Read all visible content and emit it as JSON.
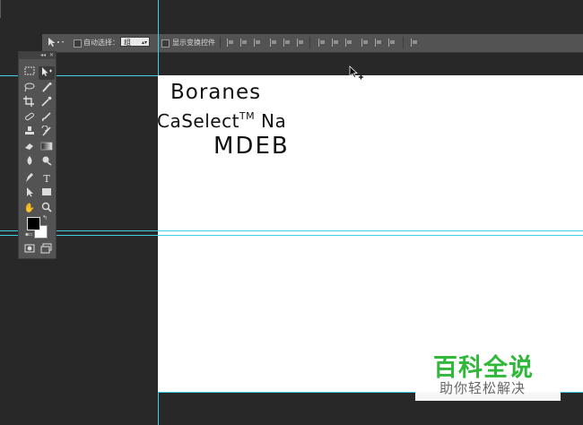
{
  "options_bar": {
    "tool_icon": "move-tool-icon",
    "auto_select_label": "自动选择：",
    "auto_select_value": "组",
    "show_transform_label": "显示变换控件"
  },
  "toolbox": {
    "collapse_glyph": "◂◂",
    "close_glyph": "✕",
    "tools": [
      "rectangular-marquee-icon",
      "move-icon",
      "lasso-icon",
      "quick-selection-icon",
      "crop-icon",
      "eyedropper-icon",
      "spot-healing-icon",
      "brush-icon",
      "clone-stamp-icon",
      "history-brush-icon",
      "eraser-icon",
      "gradient-icon",
      "blur-icon",
      "dodge-icon",
      "pen-icon",
      "type-icon",
      "path-selection-icon",
      "rectangle-shape-icon",
      "hand-icon",
      "zoom-icon",
      "quick-mask-icon",
      "screen-mode-icon"
    ],
    "foreground_color": "#000000",
    "background_color": "#ffffff"
  },
  "document": {
    "line1": "Boranes",
    "line2": "CaSelect",
    "line2_tm": "TM",
    "line2_suffix": " Na",
    "line3": "MDEB"
  },
  "watermark": {
    "title": "百科全说",
    "subtitle": "助你轻松解决",
    "title_color": "#2fb83a"
  },
  "colors": {
    "workspace": "#282828",
    "panel": "#535353",
    "guide": "#3fd0e6"
  }
}
